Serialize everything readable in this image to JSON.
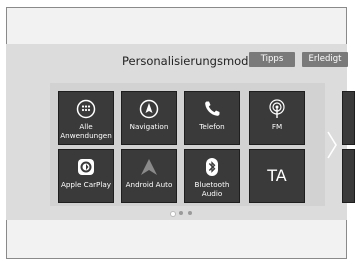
{
  "header": {
    "title": "Personalisierungsmodus",
    "tips_label": "Tipps",
    "done_label": "Erledigt"
  },
  "apps": [
    {
      "label": "Alle Anwendungen",
      "icon": "all-apps-icon"
    },
    {
      "label": "Navigation",
      "icon": "navigation-icon"
    },
    {
      "label": "Telefon",
      "icon": "phone-icon"
    },
    {
      "label": "FM",
      "icon": "radio-icon"
    },
    {
      "label": "Apple CarPlay",
      "icon": "carplay-icon"
    },
    {
      "label": "Android Auto",
      "icon": "android-auto-icon"
    },
    {
      "label": "Bluetooth Audio",
      "icon": "bluetooth-icon"
    },
    {
      "label": "TA",
      "icon": "ta-text"
    }
  ],
  "pagination": {
    "pages": 3,
    "current": 1
  },
  "colors": {
    "tile": "#3a3a3a",
    "header_button": "#7a7a7a",
    "band": "#dcdcdc"
  }
}
